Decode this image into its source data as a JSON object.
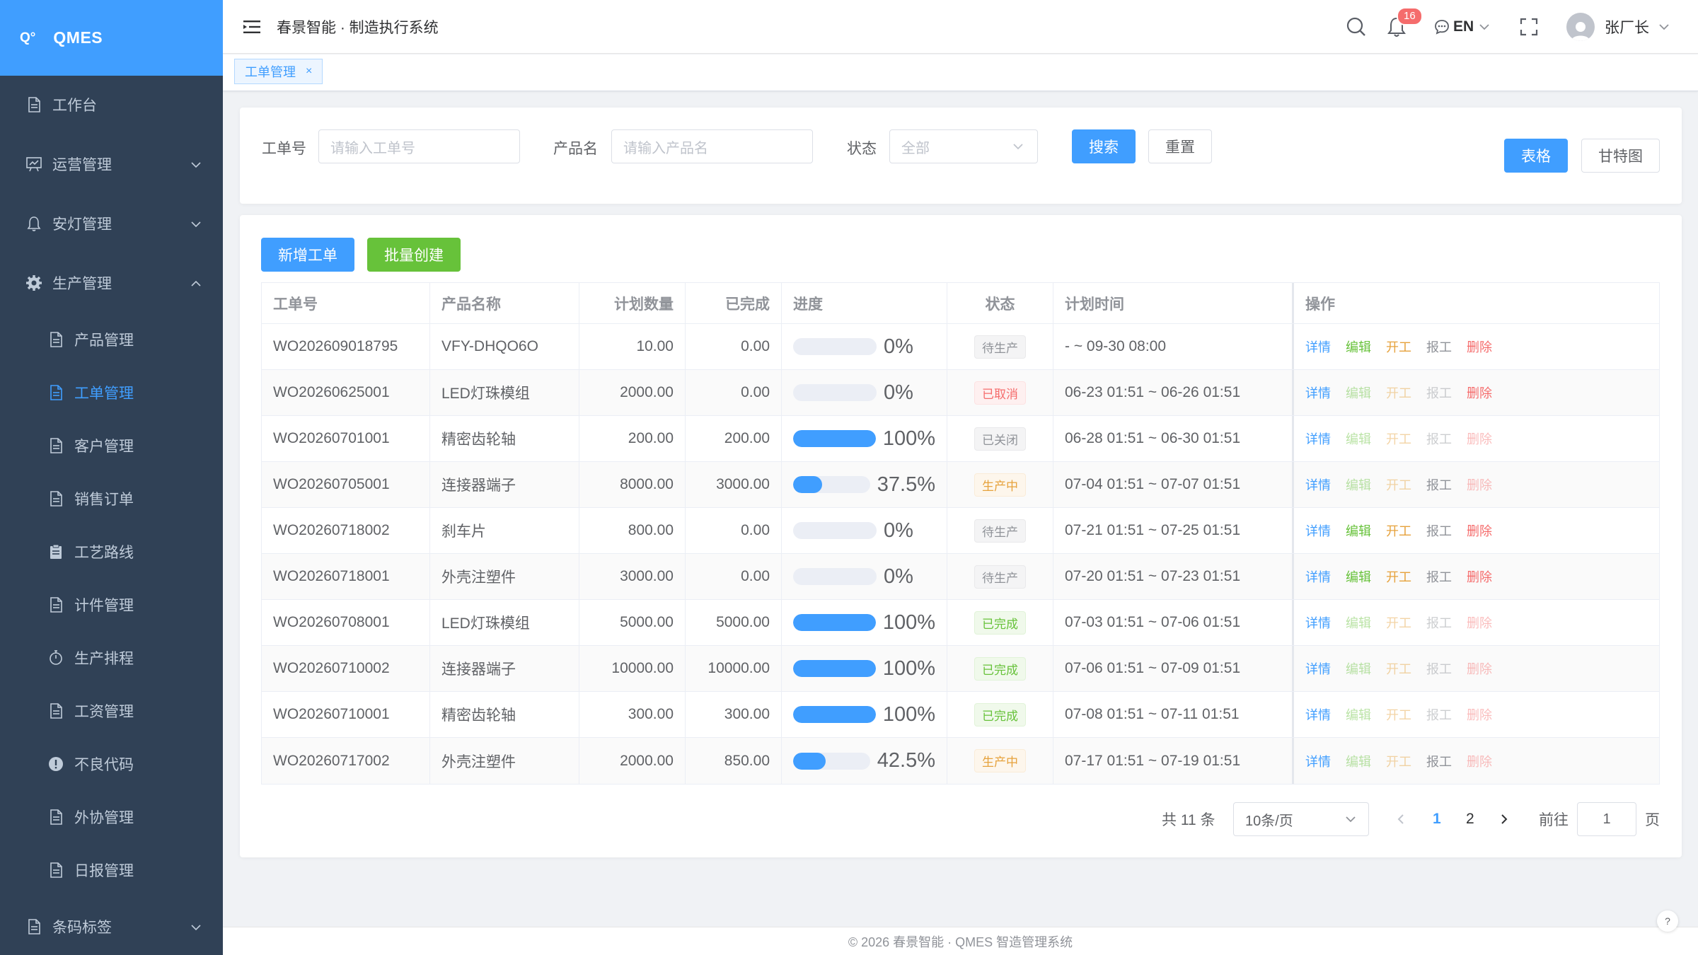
{
  "app": {
    "logo_mark": "Q°",
    "logo_text": "QMES",
    "title": "春景智能 · 制造执行系统",
    "notifications": "16",
    "language": "EN",
    "user": "张厂长"
  },
  "sidebar": {
    "items": [
      {
        "label": "工作台",
        "icon": "document-icon"
      },
      {
        "label": "运营管理",
        "icon": "chart-board-icon"
      },
      {
        "label": "安灯管理",
        "icon": "bell-icon"
      },
      {
        "label": "生产管理",
        "icon": "gear-icon"
      },
      {
        "label": "产品管理",
        "icon": "document-icon"
      },
      {
        "label": "工单管理",
        "icon": "document-icon"
      },
      {
        "label": "客户管理",
        "icon": "document-icon"
      },
      {
        "label": "销售订单",
        "icon": "document-icon"
      },
      {
        "label": "工艺路线",
        "icon": "clipboard-icon"
      },
      {
        "label": "计件管理",
        "icon": "document-icon"
      },
      {
        "label": "生产排程",
        "icon": "stopwatch-icon"
      },
      {
        "label": "工资管理",
        "icon": "document-icon"
      },
      {
        "label": "不良代码",
        "icon": "warning-icon"
      },
      {
        "label": "外协管理",
        "icon": "document-icon"
      },
      {
        "label": "日报管理",
        "icon": "document-icon"
      },
      {
        "label": "条码标签",
        "icon": "document-icon"
      }
    ]
  },
  "tabs": [
    {
      "label": "工单管理"
    }
  ],
  "search": {
    "order_no_label": "工单号",
    "order_no_placeholder": "请输入工单号",
    "product_label": "产品名",
    "product_placeholder": "请输入产品名",
    "status_label": "状态",
    "status_value": "全部",
    "search_button": "搜索",
    "reset_button": "重置",
    "view_table": "表格",
    "view_gantt": "甘特图"
  },
  "actions": {
    "add": "新增工单",
    "batch": "批量创建"
  },
  "table": {
    "headers": [
      "工单号",
      "产品名称",
      "计划数量",
      "已完成",
      "进度",
      "状态",
      "计划时间",
      "操作"
    ],
    "op_labels": [
      "详情",
      "编辑",
      "开工",
      "报工",
      "删除"
    ],
    "rows": [
      {
        "no": "WO202609018795",
        "name": "VFY-DHQO6O",
        "plan": "10.00",
        "done": "0.00",
        "progress": 0,
        "progress_text": "0%",
        "status": "待生产",
        "time": "- ~ 09-30 08:00",
        "ops": [
          1,
          1,
          1,
          1,
          1
        ]
      },
      {
        "no": "WO20260625001",
        "name": "LED灯珠模组",
        "plan": "2000.00",
        "done": "0.00",
        "progress": 0,
        "progress_text": "0%",
        "status": "已取消",
        "time": "06-23 01:51 ~ 06-26 01:51",
        "ops": [
          1,
          0,
          0,
          0,
          1
        ]
      },
      {
        "no": "WO20260701001",
        "name": "精密齿轮轴",
        "plan": "200.00",
        "done": "200.00",
        "progress": 100,
        "progress_text": "100%",
        "status": "已关闭",
        "time": "06-28 01:51 ~ 06-30 01:51",
        "ops": [
          1,
          0,
          0,
          0,
          0
        ]
      },
      {
        "no": "WO20260705001",
        "name": "连接器端子",
        "plan": "8000.00",
        "done": "3000.00",
        "progress": 37.5,
        "progress_text": "37.5%",
        "status": "生产中",
        "time": "07-04 01:51 ~ 07-07 01:51",
        "ops": [
          1,
          0,
          0,
          1,
          0
        ]
      },
      {
        "no": "WO20260718002",
        "name": "刹车片",
        "plan": "800.00",
        "done": "0.00",
        "progress": 0,
        "progress_text": "0%",
        "status": "待生产",
        "time": "07-21 01:51 ~ 07-25 01:51",
        "ops": [
          1,
          1,
          1,
          1,
          1
        ]
      },
      {
        "no": "WO20260718001",
        "name": "外壳注塑件",
        "plan": "3000.00",
        "done": "0.00",
        "progress": 0,
        "progress_text": "0%",
        "status": "待生产",
        "time": "07-20 01:51 ~ 07-23 01:51",
        "ops": [
          1,
          1,
          1,
          1,
          1
        ]
      },
      {
        "no": "WO20260708001",
        "name": "LED灯珠模组",
        "plan": "5000.00",
        "done": "5000.00",
        "progress": 100,
        "progress_text": "100%",
        "status": "已完成",
        "time": "07-03 01:51 ~ 07-06 01:51",
        "ops": [
          1,
          0,
          0,
          0,
          0
        ]
      },
      {
        "no": "WO20260710002",
        "name": "连接器端子",
        "plan": "10000.00",
        "done": "10000.00",
        "progress": 100,
        "progress_text": "100%",
        "status": "已完成",
        "time": "07-06 01:51 ~ 07-09 01:51",
        "ops": [
          1,
          0,
          0,
          0,
          0
        ]
      },
      {
        "no": "WO20260710001",
        "name": "精密齿轮轴",
        "plan": "300.00",
        "done": "300.00",
        "progress": 100,
        "progress_text": "100%",
        "status": "已完成",
        "time": "07-08 01:51 ~ 07-11 01:51",
        "ops": [
          1,
          0,
          0,
          0,
          0
        ]
      },
      {
        "no": "WO20260717002",
        "name": "外壳注塑件",
        "plan": "2000.00",
        "done": "850.00",
        "progress": 42.5,
        "progress_text": "42.5%",
        "status": "生产中",
        "time": "07-17 01:51 ~ 07-19 01:51",
        "ops": [
          1,
          0,
          0,
          1,
          0
        ]
      }
    ]
  },
  "status_colors": {
    "待生产": {
      "color": "#909399",
      "bg": "#f4f4f5",
      "border": "#e9e9eb"
    },
    "已取消": {
      "color": "#f56c6c",
      "bg": "#fef0f0",
      "border": "#fde2e2"
    },
    "已关闭": {
      "color": "#909399",
      "bg": "#f4f4f5",
      "border": "#e9e9eb"
    },
    "生产中": {
      "color": "#e6a23c",
      "bg": "#fdf6ec",
      "border": "#faecd8"
    },
    "已完成": {
      "color": "#67c23a",
      "bg": "#f0f9eb",
      "border": "#e1f3d8"
    }
  },
  "op_colors": [
    "#409eff",
    "#67c23a",
    "#e6a23c",
    "#909399",
    "#f56c6c"
  ],
  "pagination": {
    "total": "共 11 条",
    "page_size": "10条/页",
    "pages": [
      "1",
      "2"
    ],
    "current": "1",
    "goto_label": "前往",
    "goto_value": "1",
    "page_suffix": "页"
  },
  "footer": "© 2026 春景智能 · QMES 智造管理系统",
  "colors": {
    "primary": "#409eff",
    "sidebar": "#304156",
    "success": "#67c23a"
  }
}
